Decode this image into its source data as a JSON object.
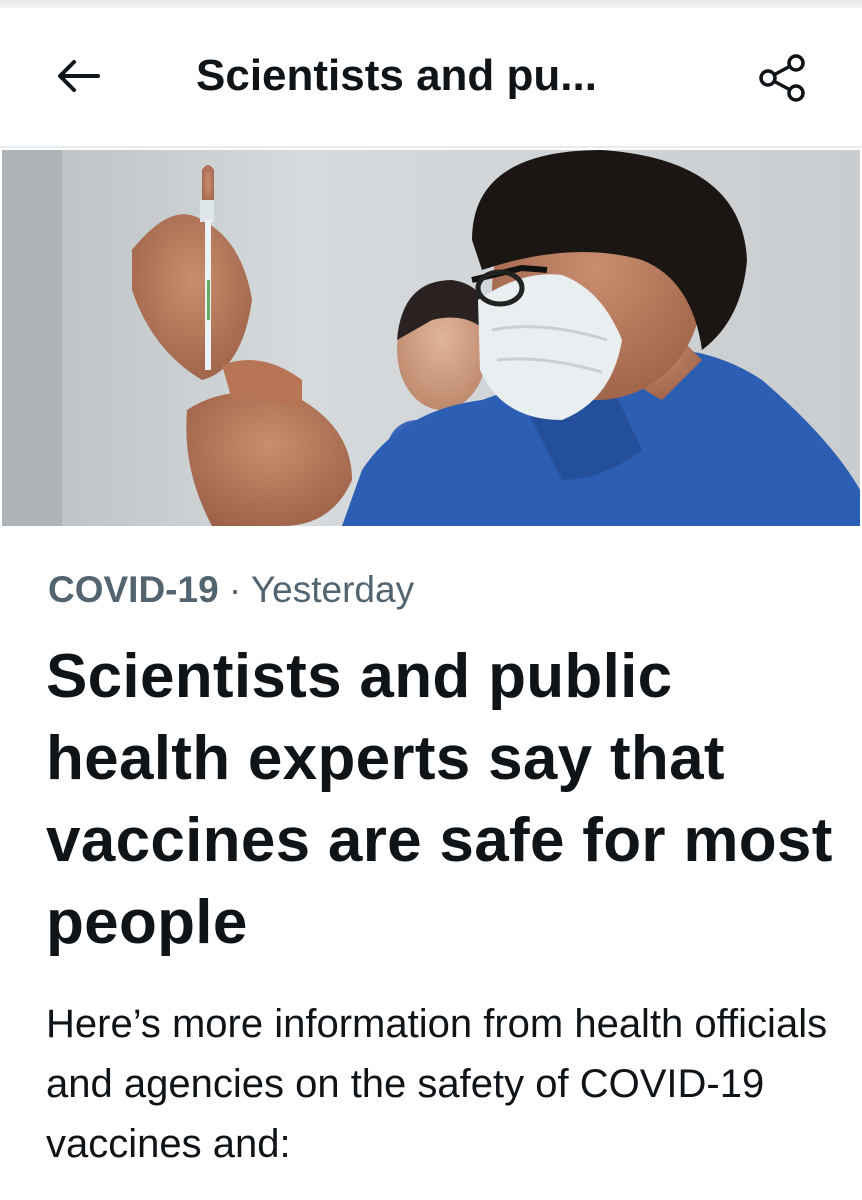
{
  "header": {
    "title": "Scientists and pu...",
    "back_icon": "arrow-left-icon",
    "share_icon": "share-icon"
  },
  "article": {
    "image_alt": "Healthcare worker in a mask and blue scrubs preparing a vaccine syringe",
    "category": "COVID-19",
    "separator": " · ",
    "time": "Yesterday",
    "headline": "Scientists and public health experts say that vaccines are safe for most people",
    "summary": "Here’s more information from health officials and agencies on the safety of COVID-19 vaccines and:"
  },
  "colors": {
    "text_primary": "#0f1419",
    "text_secondary": "#536471",
    "scrubs_blue": "#2c5fb3"
  }
}
